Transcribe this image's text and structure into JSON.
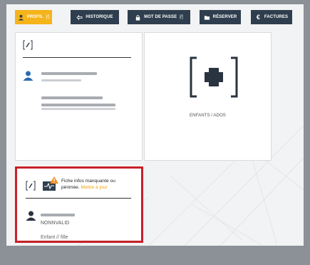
{
  "tabs": [
    {
      "label": "PROFIL",
      "icon": "user-icon",
      "active": true
    },
    {
      "label": "HISTORIQUE",
      "icon": "history-icon",
      "active": false
    },
    {
      "label": "MOT DE PASSE",
      "icon": "lock-icon",
      "active": false
    },
    {
      "label": "RÉSERVER",
      "icon": "folder-icon",
      "active": false
    },
    {
      "label": "FACTURES",
      "icon": "euro-icon",
      "active": false
    }
  ],
  "add_child": {
    "label": "ENFANTS / ADOS",
    "icon": "bracket-plus-icon"
  },
  "child_card": {
    "warning_line1": "Fiche infos manquante ou",
    "warning_line2": "périmée.",
    "update_link": "Mettre à jour",
    "status": "NONNVALID",
    "relation": "Enfant // fille"
  },
  "colors": {
    "accent": "#f4b41a",
    "tab_dark": "#2f3e4e",
    "highlight": "#c62128",
    "link": "#f4a100"
  }
}
